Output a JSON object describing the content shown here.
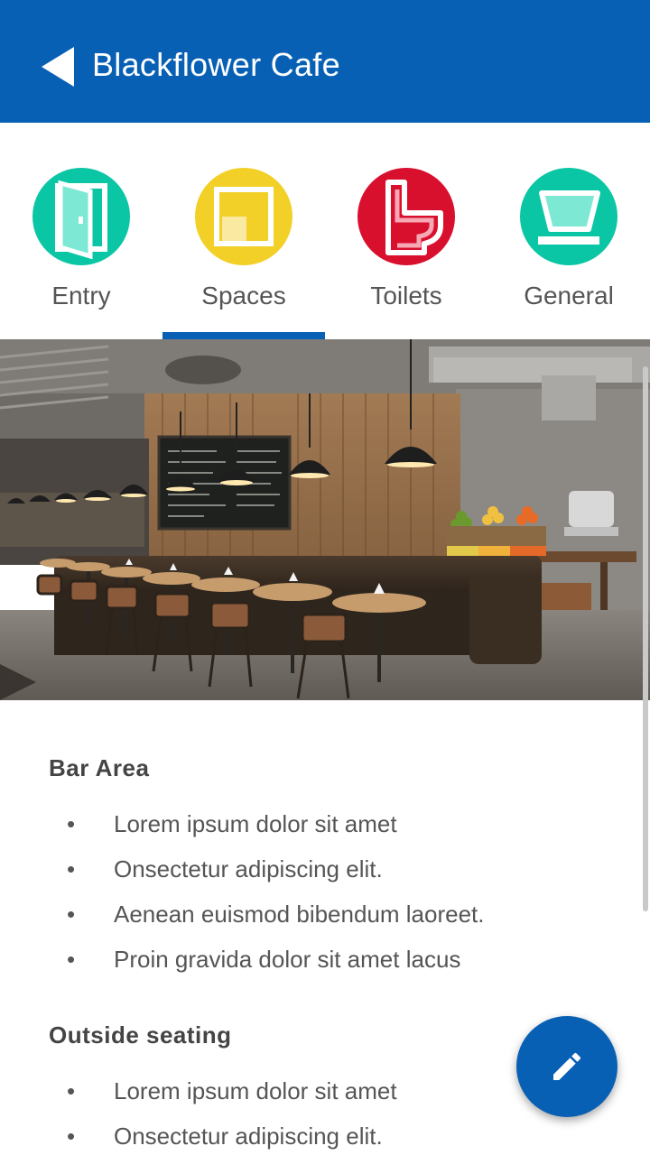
{
  "appbar": {
    "title": "Blackflower Cafe",
    "back_icon": "back-arrow-icon"
  },
  "tabs": [
    {
      "label": "Entry",
      "icon": "door-icon",
      "color": "#0AC6A4"
    },
    {
      "label": "Spaces",
      "icon": "square-space-icon",
      "color": "#F2D028"
    },
    {
      "label": "Toilets",
      "icon": "toilet-icon",
      "color": "#D8102E"
    },
    {
      "label": "General",
      "icon": "cup-icon",
      "color": "#0AC6A4"
    }
  ],
  "selected_tab": "Spaces",
  "carousel": {
    "slide_count": 6,
    "active_index": 2
  },
  "sections": [
    {
      "title": "Bar Area",
      "items": [
        "Lorem ipsum dolor sit amet",
        "Onsectetur adipiscing elit.",
        "Aenean euismod bibendum laoreet.",
        "Proin gravida dolor sit amet lacus"
      ]
    },
    {
      "title": "Outside seating",
      "items": [
        "Lorem ipsum dolor sit amet",
        "Onsectetur adipiscing elit."
      ]
    }
  ],
  "fab": {
    "icon": "edit-pencil-icon"
  },
  "colors": {
    "primary": "#0860B5"
  }
}
